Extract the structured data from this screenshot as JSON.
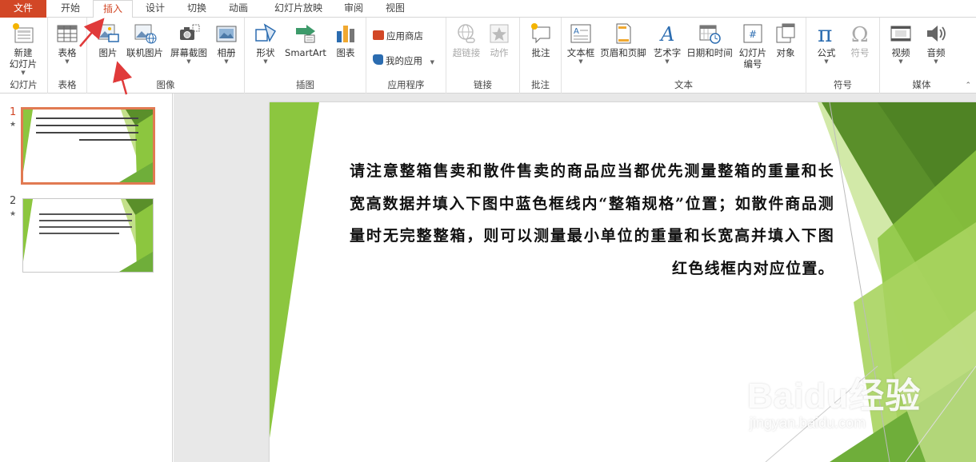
{
  "tabs": [
    "文件",
    "开始",
    "插入",
    "设计",
    "切换",
    "动画",
    "幻灯片放映",
    "审阅",
    "视图"
  ],
  "active_tab": "插入",
  "ribbon": {
    "slides": {
      "label": "幻灯片",
      "new_slide_line1": "新建",
      "new_slide_line2": "幻灯片"
    },
    "tables": {
      "label": "表格",
      "table": "表格"
    },
    "images": {
      "label": "图像",
      "picture": "图片",
      "online_picture": "联机图片",
      "screenshot": "屏幕截图",
      "album": "相册"
    },
    "illustrations": {
      "label": "插图",
      "shapes": "形状",
      "smartart": "SmartArt",
      "chart": "图表"
    },
    "apps": {
      "label": "应用程序",
      "store": "应用商店",
      "my_apps": "我的应用"
    },
    "links": {
      "label": "链接",
      "hyperlink": "超链接",
      "action": "动作"
    },
    "comments": {
      "label": "批注",
      "comment": "批注"
    },
    "text": {
      "label": "文本",
      "textbox": "文本框",
      "header_footer": "页眉和页脚",
      "wordart": "艺术字",
      "datetime": "日期和时间",
      "slide_number_line1": "幻灯片",
      "slide_number_line2": "编号",
      "object": "对象"
    },
    "symbols": {
      "label": "符号",
      "equation": "公式",
      "symbol": "符号"
    },
    "media": {
      "label": "媒体",
      "video": "视频",
      "audio": "音频"
    }
  },
  "thumbnails": [
    {
      "number": "1",
      "selected": true
    },
    {
      "number": "2",
      "selected": false
    }
  ],
  "slide_text": "请注意整箱售卖和散件售卖的商品应当都优先测量整箱的重量和长宽高数据并填入下图中蓝色框线内“整箱规格”位置；如散件商品测量时无完整整箱，则可以测量最小单位的重量和长宽高并填入下图红色线框内对应位置。",
  "watermark": {
    "main": "Baidu经验",
    "sub": "jingyan.baidu.com"
  },
  "colors": {
    "accent": "#d24726",
    "green_dark": "#5a8f2a",
    "green_mid": "#8cc63f",
    "green_light": "#c3e08a",
    "arrow": "#e03a3a"
  }
}
